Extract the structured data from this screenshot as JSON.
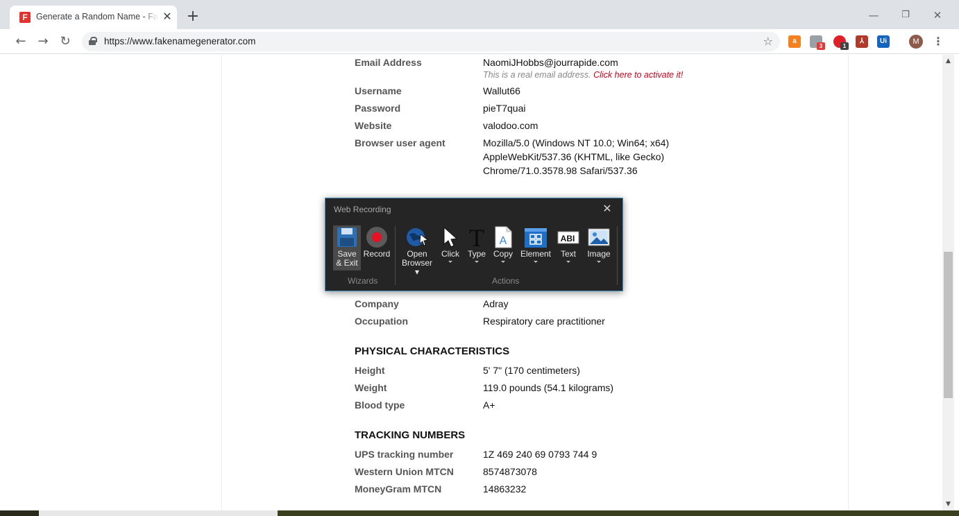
{
  "browser": {
    "tab_title": "Generate a Random Name - Fake Name Generator",
    "tab_favicon_letter": "F",
    "new_tab_symbol": "+",
    "url": "https://www.fakenamegenerator.com",
    "extensions": [
      {
        "icon": "shopping-bag-icon",
        "color": "#f48120"
      },
      {
        "icon": "puzzle-extension-icon",
        "badge": "3",
        "color": "#e33b3b"
      },
      {
        "icon": "opera-o-icon",
        "badge": "1",
        "color": "#e01f26"
      },
      {
        "icon": "pdf-icon",
        "color": "#b23a2b"
      },
      {
        "icon": "uipath-ui-icon",
        "label": "Ui",
        "color": "#1565c0"
      }
    ],
    "profile_initial": "M"
  },
  "identity": {
    "email": {
      "label": "Email Address",
      "value": "NaomiJHobbs@jourrapide.com",
      "note": "This is a real email address.",
      "note_link": "Click here to activate it!"
    },
    "username": {
      "label": "Username",
      "value": "Wallut66"
    },
    "password": {
      "label": "Password",
      "value": "pieT7quai"
    },
    "website": {
      "label": "Website",
      "value": "valodoo.com"
    },
    "user_agent": {
      "label": "Browser user agent",
      "lines": [
        "Mozilla/5.0 (Windows NT 10.0; Win64; x64)",
        "AppleWebKit/537.36 (KHTML, like Gecko)",
        "Chrome/71.0.3578.98 Safari/537.36"
      ]
    },
    "company": {
      "label": "Company",
      "value": "Adray"
    },
    "occupation": {
      "label": "Occupation",
      "value": "Respiratory care practitioner"
    }
  },
  "physical": {
    "heading": "PHYSICAL CHARACTERISTICS",
    "height": {
      "label": "Height",
      "value": "5' 7\" (170 centimeters)"
    },
    "weight": {
      "label": "Weight",
      "value": "119.0 pounds (54.1 kilograms)"
    },
    "blood": {
      "label": "Blood type",
      "value": "A+"
    }
  },
  "tracking": {
    "heading": "TRACKING NUMBERS",
    "ups": {
      "label": "UPS tracking number",
      "value": "1Z 469 240 69 0793 744 9"
    },
    "wu": {
      "label": "Western Union MTCN",
      "value": "8574873078"
    },
    "mg": {
      "label": "MoneyGram MTCN",
      "value": "14863232"
    }
  },
  "recorder": {
    "title": "Web Recording",
    "wizards": {
      "group_label": "Wizards",
      "save_exit": [
        "Save",
        "& Exit"
      ],
      "record": "Record"
    },
    "actions": {
      "group_label": "Actions",
      "open_browser": [
        "Open",
        "Browser"
      ],
      "click": "Click",
      "type": "Type",
      "copy": "Copy",
      "element": "Element",
      "text": "Text",
      "image": "Image"
    },
    "colors": {
      "background": "#252526",
      "record_red": "#e81123",
      "accent": "#3c8dbc"
    }
  }
}
